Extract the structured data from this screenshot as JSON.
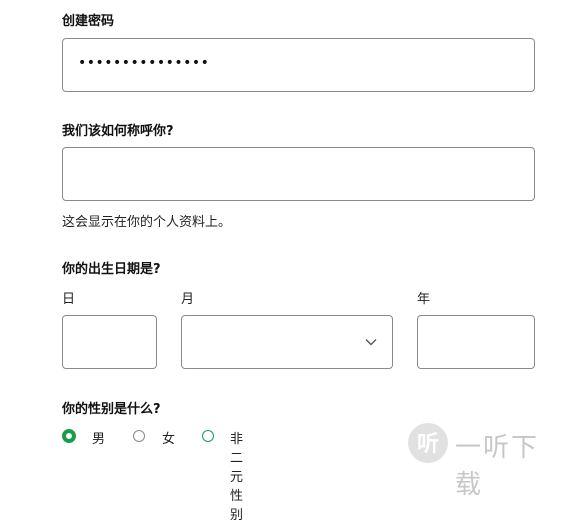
{
  "password": {
    "label": "创建密码",
    "value": "•••••••••••••••"
  },
  "display_name": {
    "label": "我们该如何称呼你?",
    "value": "",
    "helper": "这会显示在你的个人资料上。"
  },
  "birthdate": {
    "label": "你的出生日期是?",
    "day_label": "日",
    "month_label": "月",
    "year_label": "年",
    "day_value": "",
    "month_value": "",
    "year_value": ""
  },
  "gender": {
    "label": "你的性别是什么?",
    "options": [
      {
        "label": "男",
        "selected": true
      },
      {
        "label": "女",
        "selected": false
      },
      {
        "label": "非二元性别",
        "selected": false
      }
    ]
  },
  "watermark": {
    "icon_glyph": "听",
    "text": "一听下载"
  },
  "colors": {
    "accent": "#1a9d4a",
    "border": "#8a8a8a"
  },
  "icons": {
    "dropdown": "chevron-down-icon"
  }
}
